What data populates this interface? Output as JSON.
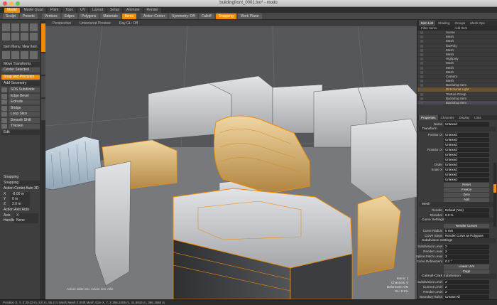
{
  "window": {
    "title": "buildingfront_0001.lxo* - modo"
  },
  "layout_tabs": [
    {
      "label": "Model",
      "active": true
    },
    {
      "label": "Model Quad",
      "active": false
    },
    {
      "label": "Paint",
      "active": false
    },
    {
      "label": "Topo",
      "active": false
    },
    {
      "label": "UV",
      "active": false
    },
    {
      "label": "Layout",
      "active": false
    },
    {
      "label": "Setup",
      "active": false
    },
    {
      "label": "Animate",
      "active": false
    },
    {
      "label": "Render",
      "active": false
    }
  ],
  "toolbar": {
    "sculpt": "Sculpt",
    "presets": "Presets",
    "vertices": "Vertices",
    "edges": "Edges",
    "polygons": "Polygons",
    "materials": "Materials",
    "items": "Items",
    "action_center": "Action Center",
    "symmetry": "Symmetry: Off",
    "falloff": "Falloff",
    "snapping": "Snapping",
    "work_plane": "Work Plane"
  },
  "left_panel": {
    "item_menu": "Item Menu: New Item",
    "move_transforms": "Move Transforms",
    "center_selected": "Center Selected",
    "snap_precision": "Snap and Precision",
    "add_geometry": "Add Geometry",
    "tools": [
      "SDS Subdivide",
      "Edge Bevel",
      "Extrude",
      "Bridge",
      "Loop Slice",
      "Smooth Shift",
      "Thicken"
    ],
    "edit": "Edit",
    "snapping": "Snapping",
    "snapping_value": "Snapping",
    "action_center_auto": "Action Center Auto 3D",
    "x_label": "X",
    "x_value": "-8.00 m",
    "y_label": "Y",
    "y_value": "0 m",
    "z_label": "Z",
    "z_value": "2.0 m",
    "action_axis": "Action Axis Auto",
    "axis_label": "Axis",
    "axis_value": "X",
    "handle_label": "Handle",
    "handle_value": "None"
  },
  "viewport": {
    "tabs": [
      "Perspective",
      "Untextured Preview",
      "Ray GL: Off"
    ],
    "hint": "Action table inst. Action inst. Allie",
    "info": [
      "Items: 1",
      "Channels: 0",
      "Deformers: ON",
      "GL: 0.1%"
    ]
  },
  "item_list": {
    "tabs": [
      "Item List",
      "Shading",
      "Groups",
      "Mesh Ops"
    ],
    "header_filter": "Filter Items",
    "header_add": "Add Item",
    "items": [
      {
        "label": "Scene",
        "state": "normal"
      },
      {
        "label": "Mesh",
        "state": "normal"
      },
      {
        "label": "Mesh",
        "state": "normal"
      },
      {
        "label": "lowPoly",
        "state": "normal"
      },
      {
        "label": "Mesh",
        "state": "normal"
      },
      {
        "label": "Mesh",
        "state": "normal"
      },
      {
        "label": "Highpoly",
        "state": "normal"
      },
      {
        "label": "Mesh",
        "state": "normal"
      },
      {
        "label": "Mesh",
        "state": "normal"
      },
      {
        "label": "Mesh",
        "state": "normal"
      },
      {
        "label": "Camera",
        "state": "normal"
      },
      {
        "label": "Mesh",
        "state": "normal"
      },
      {
        "label": "Backdrop Item",
        "state": "normal"
      },
      {
        "label": "Directional Light",
        "state": "highlight"
      },
      {
        "label": "Texture Group",
        "state": "normal"
      },
      {
        "label": "Backdrop Item",
        "state": "normal"
      },
      {
        "label": "Backdrop Item",
        "state": "selected"
      }
    ]
  },
  "properties": {
    "tabs": [
      "Properties",
      "Channels",
      "Display",
      "Lists"
    ],
    "name_label": "Name",
    "name_value": "Untexed",
    "transform_section": "Transform",
    "position_label": "Position X",
    "position_values": [
      "Untexed",
      "Untexed",
      "Untexed"
    ],
    "rotation_label": "Rotation X",
    "rotation_values": [
      "Untexed",
      "Untexed",
      "Untexed"
    ],
    "order_label": "Order",
    "order_value": "Untexed",
    "scale_label": "Scale X",
    "scale_values": [
      "Untexed",
      "Untexed",
      "Untexed"
    ],
    "reset": "Reset",
    "freeze": "Freeze",
    "zero": "Zero",
    "add": "Add",
    "mesh_section": "Mesh",
    "render_label": "Render",
    "render_value": "Default (Yes)",
    "dissolve_label": "Dissolve",
    "dissolve_value": "0.0 %",
    "curve_settings": "Curve Settings",
    "render_curves": "Render Curves",
    "curve_radius_label": "Curve Radius",
    "curve_radius_value": "5 mm",
    "curve_steps_label": "Curve Steps",
    "curve_steps_value": "Render Curve as Polygons",
    "subdivision_section": "Subdivision Settings",
    "subdivision_level_label": "Subdivision Level",
    "subdivision_level_value": "2",
    "render_level_label": "Render Level",
    "render_level_value": "2",
    "spline_patch_label": "Spline Patch Level",
    "spline_patch_value": "3",
    "curve_refinement_label": "Curve Refinement",
    "curve_refinement_value": "0.1 °",
    "linear_uvs": "Linear UVs",
    "cage": "Cage",
    "catmull_section": "Catmull-Clark Subdivision",
    "cc_subdivision_label": "Subdivision Level",
    "cc_subdivision_value": "2",
    "cc_current_label": "Current Level",
    "cc_current_value": "2",
    "cc_render_label": "Render Level",
    "cc_render_value": "2",
    "boundary_label": "Boundary Rules",
    "boundary_value": "Crease All"
  },
  "status_bar": "Position X, Y, Z  20.33 m, 8.0 m, 55.2 m   Mesh   Mesh 0   Shift   Mesh   Size X, Y, Z  256.2205 m, 41.5915 m, 396.1558 m"
}
